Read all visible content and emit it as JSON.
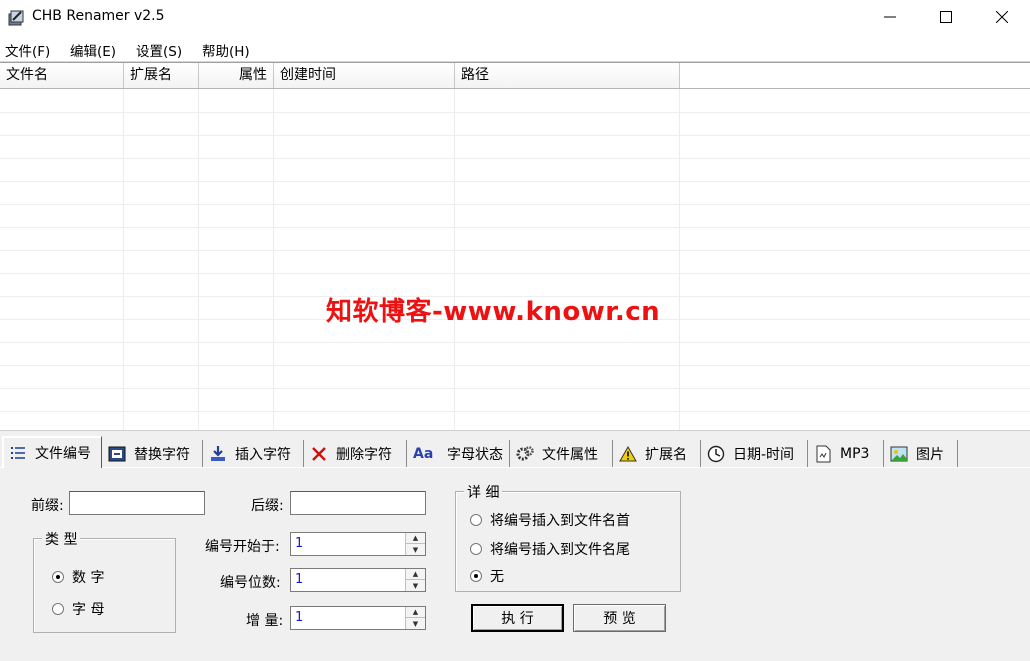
{
  "window": {
    "title": "CHB Renamer v2.5",
    "minimize_label": "Minimize",
    "maximize_label": "Maximize",
    "close_label": "Close"
  },
  "menu": [
    "文件(F)",
    "编辑(E)",
    "设置(S)",
    "帮助(H)"
  ],
  "list": {
    "columns": [
      "文件名",
      "扩展名",
      "属性",
      "创建时间",
      "路径"
    ],
    "rows": []
  },
  "watermark": "知软博客-www.knowr.cn",
  "tabs": [
    {
      "label": "文件编号",
      "icon": "list-numbered-icon",
      "active": true
    },
    {
      "label": "替换字符",
      "icon": "replace-icon",
      "active": false
    },
    {
      "label": "插入字符",
      "icon": "insert-icon",
      "active": false
    },
    {
      "label": "删除字符",
      "icon": "delete-x-icon",
      "active": false
    },
    {
      "label": "字母状态",
      "icon": "letter-case-icon",
      "active": false
    },
    {
      "label": "文件属性",
      "icon": "gears-icon",
      "active": false
    },
    {
      "label": "扩展名",
      "icon": "warning-icon",
      "active": false
    },
    {
      "label": "日期-时间",
      "icon": "clock-icon",
      "active": false
    },
    {
      "label": "MP3",
      "icon": "mp3-file-icon",
      "active": false
    },
    {
      "label": "图片",
      "icon": "picture-icon",
      "active": false
    }
  ],
  "numbering": {
    "prefix_label": "前缀:",
    "prefix_value": "",
    "suffix_label": "后缀:",
    "suffix_value": "",
    "type_group_title": "类 型",
    "type_options": [
      {
        "label": "数 字",
        "selected": true
      },
      {
        "label": "字 母",
        "selected": false
      }
    ],
    "start_label": "编号开始于:",
    "start_value": "1",
    "digits_label": "编号位数:",
    "digits_value": "1",
    "increment_label": "增 量:",
    "increment_value": "1",
    "detail_group_title": "详 细",
    "detail_options": [
      {
        "label": "将编号插入到文件名首",
        "selected": false
      },
      {
        "label": "将编号插入到文件名尾",
        "selected": false
      },
      {
        "label": "无",
        "selected": true
      }
    ],
    "execute_label": "执 行",
    "preview_label": "预 览"
  }
}
